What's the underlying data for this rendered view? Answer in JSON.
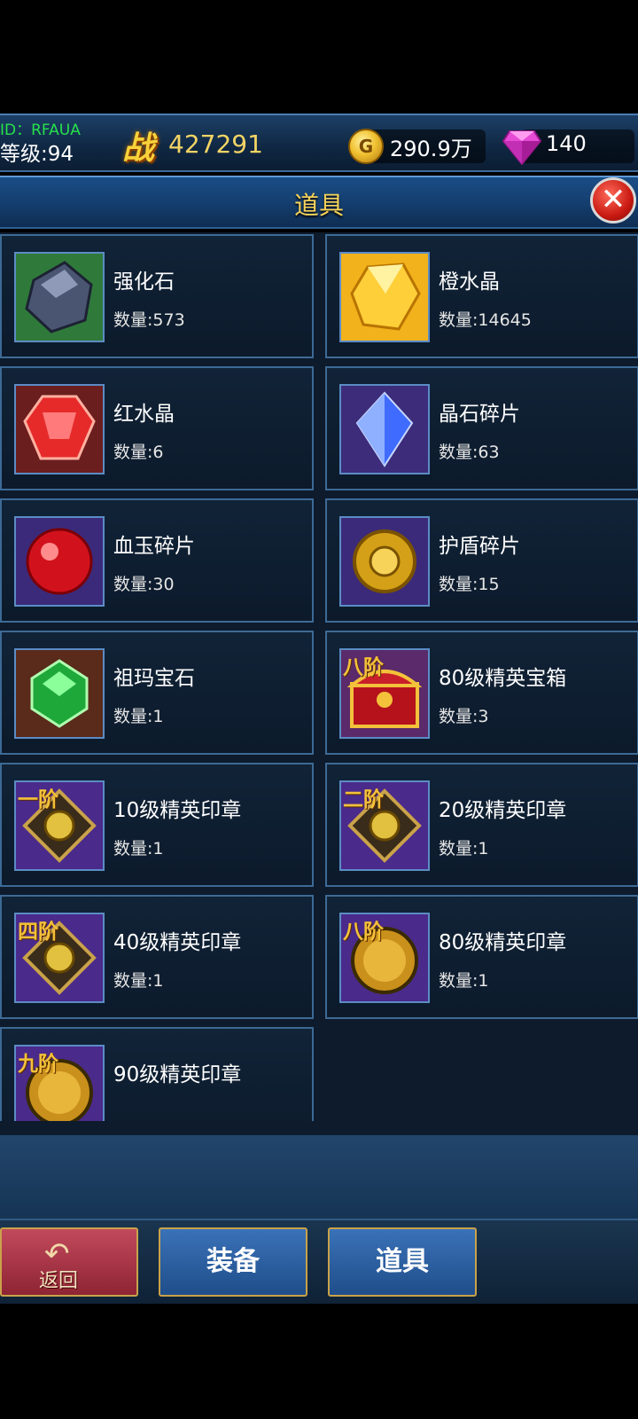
{
  "player": {
    "id_text": "ID：RFAUA",
    "level_text": "等级:94",
    "power_label": "战",
    "power_value": "427291",
    "gold_icon": "G",
    "gold_value": "290.9万",
    "gem_value": "140"
  },
  "panel": {
    "title": "道具",
    "close_icon": "close-icon"
  },
  "items": [
    {
      "name": "强化石",
      "count": "数量:573",
      "icon": "stone-icon",
      "tier": ""
    },
    {
      "name": "橙水晶",
      "count": "数量:14645",
      "icon": "orange-crystal-icon",
      "tier": ""
    },
    {
      "name": "红水晶",
      "count": "数量:6",
      "icon": "red-crystal-icon",
      "tier": ""
    },
    {
      "name": "晶石碎片",
      "count": "数量:63",
      "icon": "crystal-shard-icon",
      "tier": ""
    },
    {
      "name": "血玉碎片",
      "count": "数量:30",
      "icon": "blood-jade-icon",
      "tier": ""
    },
    {
      "name": "护盾碎片",
      "count": "数量:15",
      "icon": "shield-shard-icon",
      "tier": ""
    },
    {
      "name": "祖玛宝石",
      "count": "数量:1",
      "icon": "zuma-gem-icon",
      "tier": ""
    },
    {
      "name": "80级精英宝箱",
      "count": "数量:3",
      "icon": "treasure-chest-icon",
      "tier": "八阶"
    },
    {
      "name": "10级精英印章",
      "count": "数量:1",
      "icon": "seal-icon",
      "tier": "一阶"
    },
    {
      "name": "20级精英印章",
      "count": "数量:1",
      "icon": "seal-icon",
      "tier": "二阶"
    },
    {
      "name": "40级精英印章",
      "count": "数量:1",
      "icon": "seal-icon",
      "tier": "四阶"
    },
    {
      "name": "80级精英印章",
      "count": "数量:1",
      "icon": "medal-icon",
      "tier": "八阶"
    },
    {
      "name": "90级精英印章",
      "count": "",
      "icon": "medal-icon",
      "tier": "九阶"
    }
  ],
  "nav": {
    "back_label": "返回",
    "equip_label": "装备",
    "items_label": "道具"
  },
  "colors": {
    "title_gold": "#f7d45a",
    "card_border": "#3d6a95",
    "id_green": "#27e04a"
  }
}
